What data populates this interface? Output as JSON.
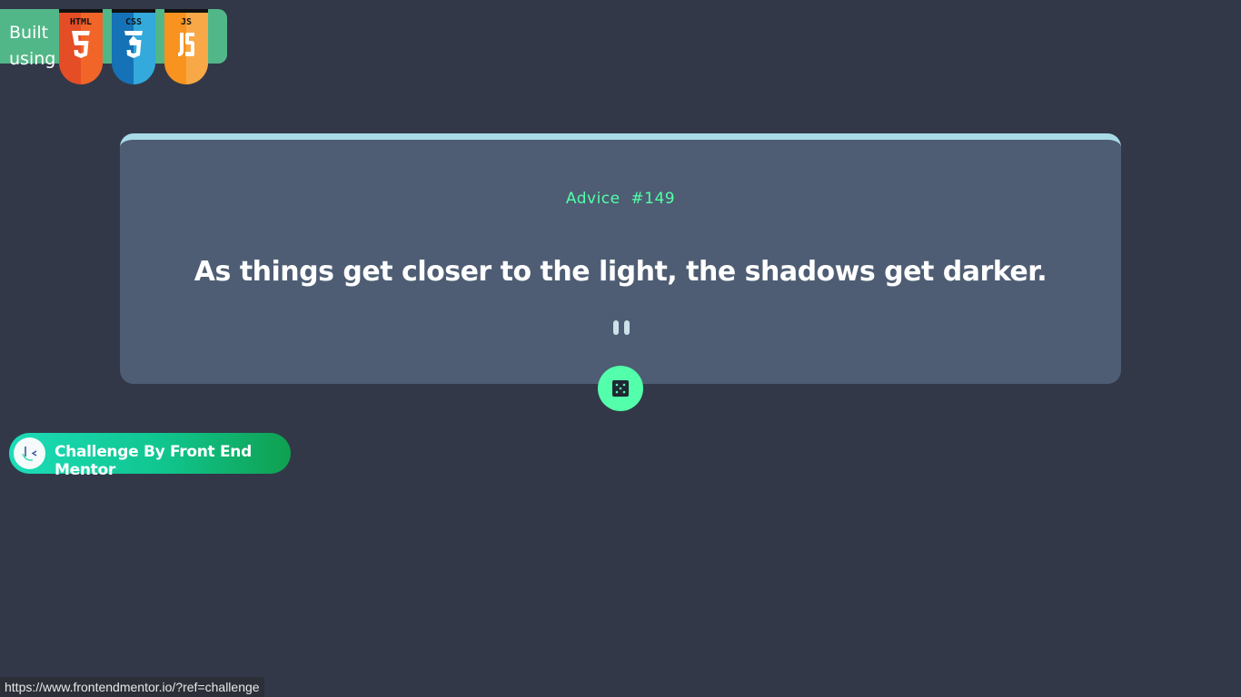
{
  "built_with": {
    "label_line1": "Built",
    "label_line2": "using",
    "badges": [
      {
        "name": "html5-shield-icon",
        "label": "HTML",
        "glyph": "5",
        "color": "#e44d26",
        "dark": "#f16529"
      },
      {
        "name": "css3-shield-icon",
        "label": "CSS",
        "glyph": "3",
        "color": "#1572b6",
        "dark": "#33a9dc"
      },
      {
        "name": "js-shield-icon",
        "label": "JS",
        "glyph": "JS",
        "color": "#f7931e",
        "dark": "#f9a848"
      }
    ]
  },
  "advice": {
    "label": "Advice  #149",
    "quote": "As things get closer to the light, the shadows get darker."
  },
  "dice_button": {
    "icon": "dice-icon"
  },
  "challenge": {
    "label": "Challenge By Front End Mentor",
    "icon": "frontend-mentor-logo-icon"
  },
  "status_bar": {
    "url": "https://www.frontendmentor.io/?ref=challenge"
  },
  "colors": {
    "background": "#323848",
    "card": "#4e5d73",
    "accent": "#53ffaa",
    "card_top_border": "#a8dbe6"
  }
}
